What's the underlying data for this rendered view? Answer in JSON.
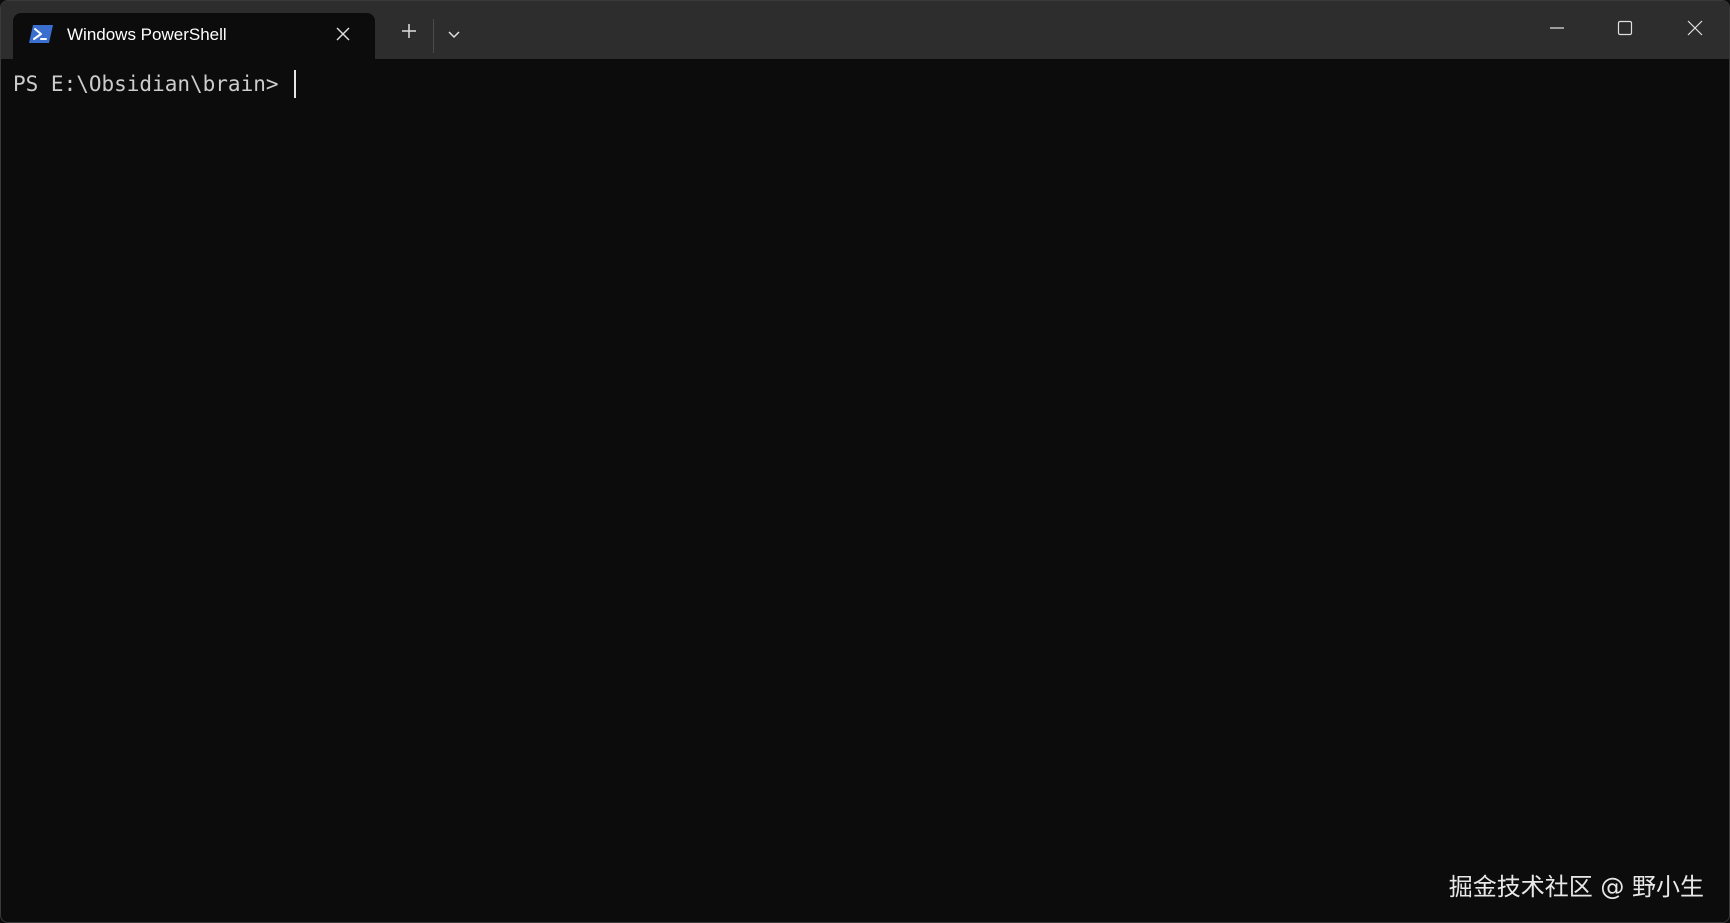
{
  "window": {
    "tab": {
      "title": "Windows PowerShell",
      "icon": "powershell-icon",
      "icon_color": "#3a6fd0"
    },
    "buttons": {
      "new_tab_icon": "plus-icon",
      "dropdown_icon": "chevron-down-icon",
      "close_tab_icon": "close-icon",
      "minimize_icon": "minimize-icon",
      "maximize_icon": "maximize-icon",
      "close_window_icon": "close-icon"
    },
    "colors": {
      "titlebar": "#2d2d2d",
      "terminal_bg": "#0c0c0c",
      "text": "#cccccc"
    }
  },
  "terminal": {
    "prompt": "PS E:\\Obsidian\\brain> "
  },
  "watermark": {
    "text": "掘金技术社区 @ 野小生"
  }
}
